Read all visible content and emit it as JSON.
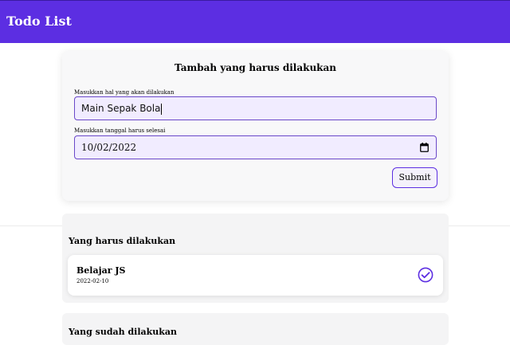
{
  "app": {
    "title": "Todo List"
  },
  "form": {
    "heading": "Tambah yang harus dilakukan",
    "title_label": "Masukkan hal yang akan dilakukan",
    "title_value": "Main Sepak Bola",
    "date_label": "Masukkan tanggal harus selesai",
    "date_value": "10/02/2022",
    "submit_label": "Submit"
  },
  "incomplete": {
    "heading": "Yang harus dilakukan",
    "items": [
      {
        "title": "Belajar JS",
        "date": "2022-02-10"
      }
    ]
  },
  "completed": {
    "heading": "Yang sudah dilakukan"
  },
  "colors": {
    "accent": "#5c2ee2",
    "input_bg": "#f1ecff"
  },
  "icons": {
    "calendar": "calendar-icon",
    "check": "check-circle-icon"
  }
}
